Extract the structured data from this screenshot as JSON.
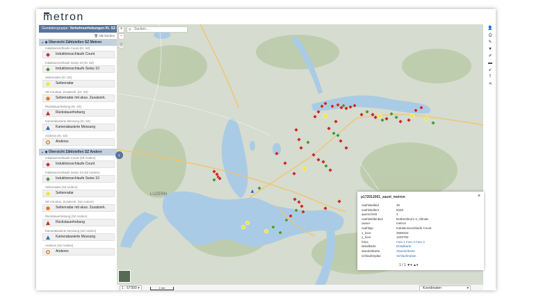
{
  "app": {
    "logo": "metron"
  },
  "sidebar": {
    "theme_label": "Geodatengruppe:",
    "theme_value": "Verkehrserhebungen Kt. SZ",
    "show_all": "Alle löschen",
    "groups": [
      {
        "title": "Übersicht Zählstellen SZ Metron",
        "layers": [
          {
            "title": "Induktionsschlaufe Count (Kt. SZ)",
            "legend": "Induktionsschlaufe Count",
            "symbol": "diamond",
            "color": "#c7312b"
          },
          {
            "title": "Induktionsschlaufe Swiss 10 (Kt. SZ)",
            "legend": "Induktionsschlaufe Swiss 10",
            "symbol": "diamond",
            "color": "#4f9a3c"
          },
          {
            "title": "Seitenradar (Kt. SZ)",
            "legend": "Seitenradar",
            "symbol": "circle",
            "color": "#f2e53a"
          },
          {
            "title": "SR mit akus. Zusatzerk. (Kt. SZ)",
            "legend": "Seitenradar mit akus. Zusatzerk.",
            "symbol": "circle",
            "color": "#e07b22"
          },
          {
            "title": "Rückstauerhebung (Kt. SZ)",
            "legend": "Rückstauerhebung",
            "symbol": "triangle",
            "color": "#c7312b"
          },
          {
            "title": "Kamerabasierte Messung (Kt. SZ)",
            "legend": "Kamerabasierte Messung",
            "symbol": "triangle",
            "color": "#3d6db3"
          },
          {
            "title": "Anderes (Kt. SZ)",
            "legend": "Anderes",
            "symbol": "ring",
            "color": "#e07b22"
          }
        ]
      },
      {
        "title": "Übersicht Zählstellen SZ Andere",
        "layers": [
          {
            "title": "Induktionsschlaufe Count (SZ Andere)",
            "legend": "Induktionsschlaufe Count",
            "symbol": "diamond",
            "color": "#c7312b"
          },
          {
            "title": "Induktionsschlaufe Swiss 10 (SZ Andere)",
            "legend": "Induktionsschlaufe Swiss 10",
            "symbol": "diamond",
            "color": "#4f9a3c"
          },
          {
            "title": "Seitenradar (SZ Andere)",
            "legend": "Seitenradar",
            "symbol": "circle",
            "color": "#f2e53a"
          },
          {
            "title": "SR mit akus. Zusatzerk. (SZ Andere)",
            "legend": "Seitenradar mit akus. Zusatzerk.",
            "symbol": "circle",
            "color": "#e07b22"
          },
          {
            "title": "Rückstauerhebung (SZ Andere)",
            "legend": "Rückstauerhebung",
            "symbol": "triangle",
            "color": "#c7312b"
          },
          {
            "title": "Kamerabasierte Messung (SZ Andere)",
            "legend": "Kamerabasierte Messung",
            "symbol": "triangle",
            "color": "#3d6db3"
          },
          {
            "title": "Anderes (SZ Andere)",
            "legend": "Anderes",
            "symbol": "ring",
            "color": "#e07b22"
          }
        ]
      }
    ]
  },
  "map": {
    "search_placeholder": "Suchen...",
    "city_label": "LUZERN",
    "colors": {
      "water": "#a9cbe6",
      "land": "#d6dccf",
      "forest": "#b9caa8",
      "road": "#f4c26b"
    }
  },
  "popup": {
    "title": "p172012001_zaunt_metron",
    "rows": [
      {
        "k": "zaehlstelleid",
        "v": "30"
      },
      {
        "k": "zaehlstellenr",
        "v": "8345"
      },
      {
        "k": "querschnitt",
        "v": "1"
      },
      {
        "k": "zaehlstellenbez",
        "v": "Rothenthurm 3, Allmatt"
      },
      {
        "k": "owner",
        "v": "metron"
      },
      {
        "k": "zaehltyp",
        "v": "Induktionsschlaufe Count"
      },
      {
        "k": "x_koor",
        "v": "2695324"
      },
      {
        "k": "y_koor",
        "v": "1220792"
      },
      {
        "k": "fotos",
        "v": "Foto 1 Foto 2 Foto 3",
        "link": true
      },
      {
        "k": "detailkarte",
        "v": "Detailkarte",
        "link": true
      },
      {
        "k": "standortkarte",
        "v": "Standortkarte",
        "link": true
      },
      {
        "k": "schlaufenplan",
        "v": "Schlaufenplan",
        "link": true
      }
    ],
    "nav": "1 / 1"
  },
  "status": {
    "scale": "1 : 57'000",
    "scalebar": "1 km",
    "coords": "Koordinaten"
  }
}
